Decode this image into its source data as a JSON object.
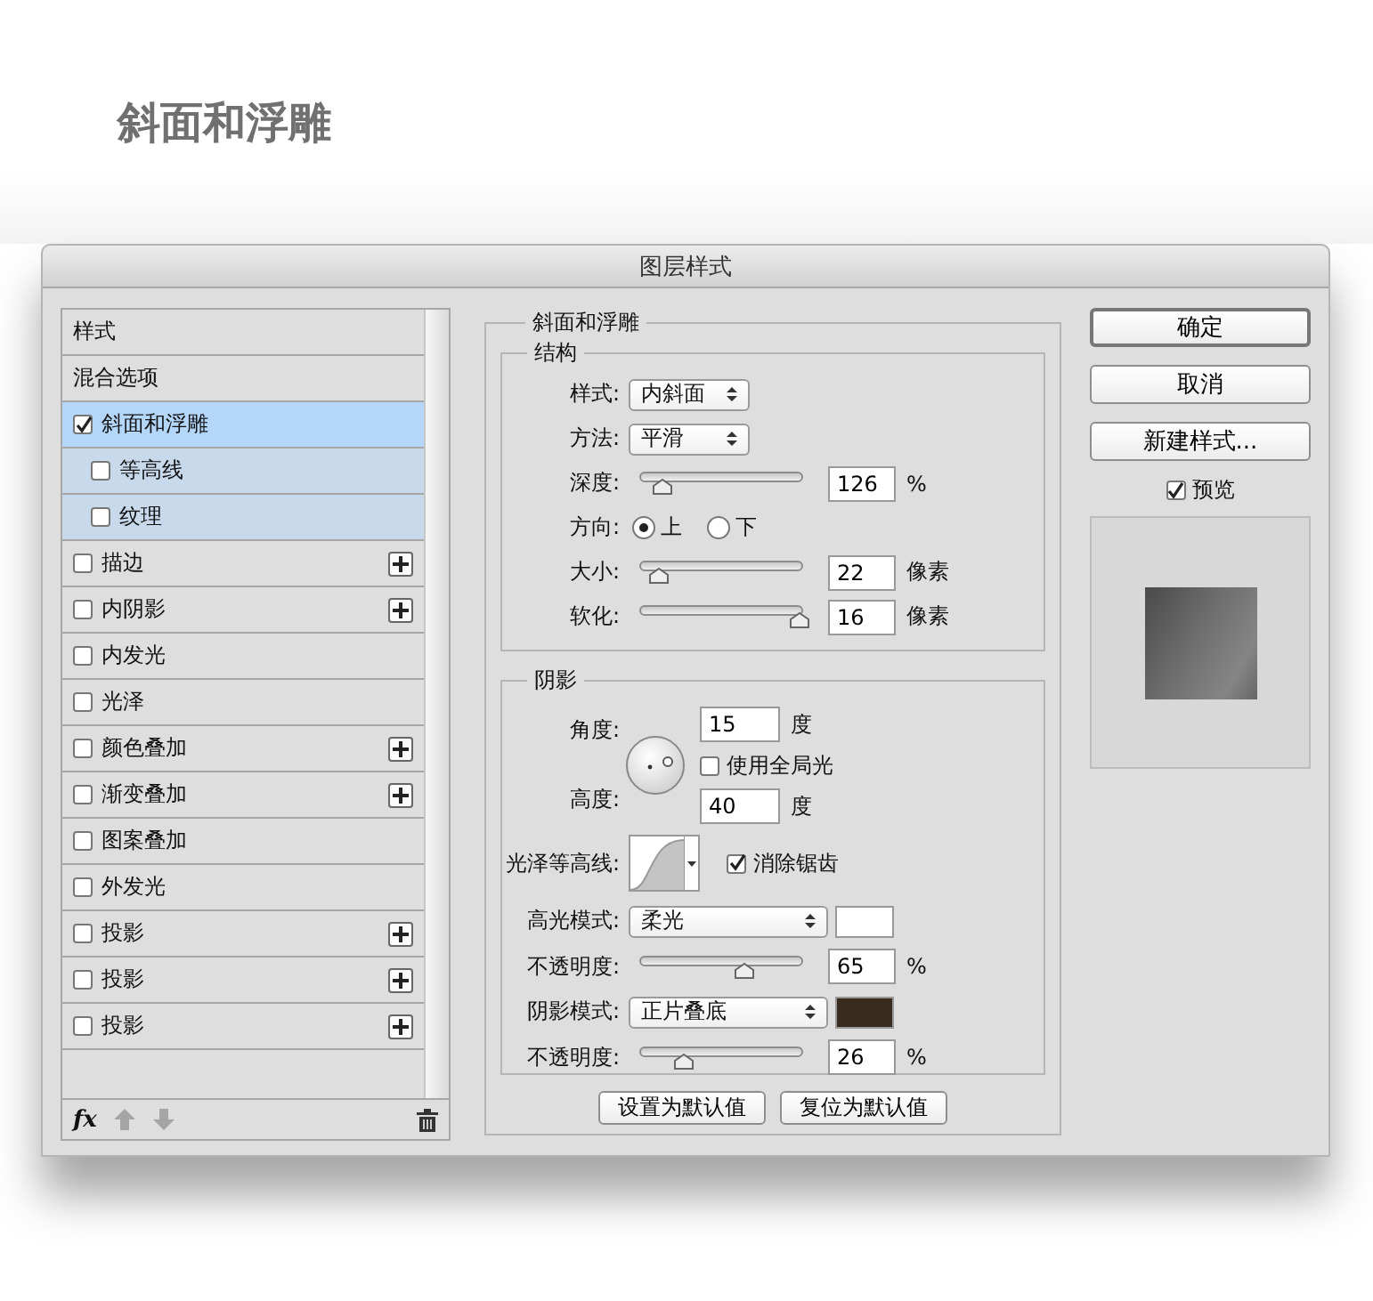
{
  "heading": "斜面和浮雕",
  "dialog": {
    "title": "图层样式"
  },
  "style_list": {
    "items": [
      {
        "label": "样式",
        "kind": "header",
        "selected": false
      },
      {
        "label": "混合选项",
        "kind": "header",
        "selected": false
      },
      {
        "label": "斜面和浮雕",
        "kind": "effect",
        "checked": true,
        "selected": true,
        "children": [
          {
            "label": "等高线",
            "kind": "effect",
            "checked": false,
            "selected": false
          },
          {
            "label": "纹理",
            "kind": "effect",
            "checked": false,
            "selected": false
          }
        ]
      },
      {
        "label": "描边",
        "kind": "effect",
        "checked": false,
        "selected": false,
        "addable": true
      },
      {
        "label": "内阴影",
        "kind": "effect",
        "checked": false,
        "selected": false,
        "addable": true
      },
      {
        "label": "内发光",
        "kind": "effect",
        "checked": false,
        "selected": false
      },
      {
        "label": "光泽",
        "kind": "effect",
        "checked": false,
        "selected": false
      },
      {
        "label": "颜色叠加",
        "kind": "effect",
        "checked": false,
        "selected": false,
        "addable": true
      },
      {
        "label": "渐变叠加",
        "kind": "effect",
        "checked": false,
        "selected": false,
        "addable": true
      },
      {
        "label": "图案叠加",
        "kind": "effect",
        "checked": false,
        "selected": false
      },
      {
        "label": "外发光",
        "kind": "effect",
        "checked": false,
        "selected": false
      },
      {
        "label": "投影",
        "kind": "effect",
        "checked": false,
        "selected": false,
        "addable": true
      },
      {
        "label": "投影",
        "kind": "effect",
        "checked": false,
        "selected": false,
        "addable": true
      },
      {
        "label": "投影",
        "kind": "effect",
        "checked": false,
        "selected": false,
        "addable": true
      }
    ],
    "toolbar": {
      "fx": "fx"
    }
  },
  "bevel": {
    "title": "斜面和浮雕",
    "structure": {
      "title": "结构",
      "rows": [
        {
          "kind": "select",
          "label": "样式:",
          "value": "内斜面"
        },
        {
          "kind": "select",
          "label": "方法:",
          "value": "平滑"
        },
        {
          "kind": "slider",
          "label": "深度:",
          "level": 0.12,
          "value": "126",
          "unit": "%"
        },
        {
          "kind": "radio",
          "label": "方向:",
          "options": [
            {
              "label": "上",
              "selected": true
            },
            {
              "label": "下",
              "selected": false
            }
          ]
        },
        {
          "kind": "slider",
          "label": "大小:",
          "level": 0.1,
          "value": "22",
          "unit": "像素"
        },
        {
          "kind": "slider",
          "label": "软化:",
          "level": 1.0,
          "value": "16",
          "unit": "像素"
        }
      ]
    },
    "shading": {
      "title": "阴影",
      "angle": {
        "label": "角度:",
        "value": "15",
        "unit": "度"
      },
      "global_light": {
        "label": "使用全局光",
        "checked": false
      },
      "altitude": {
        "label": "高度:",
        "value": "40",
        "unit": "度"
      },
      "gloss_contour": {
        "label": "光泽等高线:"
      },
      "anti_aliased": {
        "label": "消除锯齿",
        "checked": true
      },
      "rows": [
        {
          "kind": "mode",
          "label": "高光模式:",
          "value": "柔光",
          "color": "#ffffff"
        },
        {
          "kind": "slider",
          "label": "不透明度:",
          "level": 0.65,
          "value": "65",
          "unit": "%"
        },
        {
          "kind": "mode",
          "label": "阴影模式:",
          "value": "正片叠底",
          "color": "#392b1e"
        },
        {
          "kind": "slider",
          "label": "不透明度:",
          "level": 0.26,
          "value": "26",
          "unit": "%"
        }
      ]
    },
    "buttons": [
      "设置为默认值",
      "复位为默认值"
    ]
  },
  "actions": [
    {
      "label": "确定",
      "default": true
    },
    {
      "label": "取消",
      "default": false
    },
    {
      "label": "新建样式...",
      "default": false
    }
  ],
  "preview": {
    "label": "预览",
    "checked": true
  }
}
